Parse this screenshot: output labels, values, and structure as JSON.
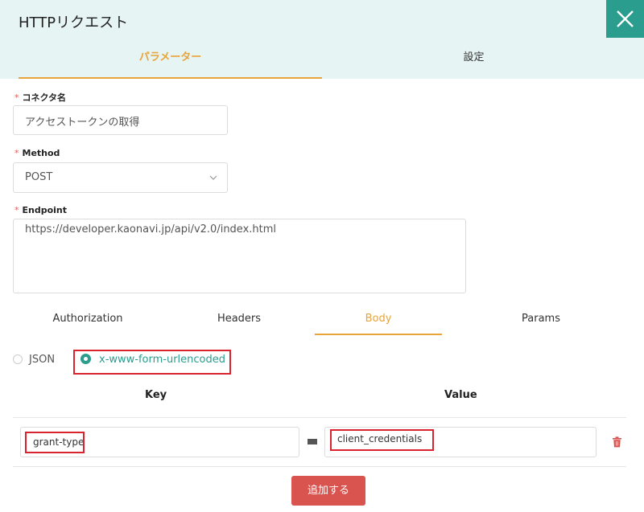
{
  "window": {
    "title": "HTTPリクエスト"
  },
  "tabs_top": [
    {
      "label": "パラメーター",
      "active": true
    },
    {
      "label": "設定",
      "active": false
    }
  ],
  "connector": {
    "label": "コネクタ名",
    "value": "アクセストークンの取得"
  },
  "method": {
    "label": "Method",
    "value": "POST"
  },
  "endpoint": {
    "label": "Endpoint",
    "value": "https://developer.kaonavi.jp/api/v2.0/index.html"
  },
  "required_mark": "*",
  "subtabs": [
    {
      "label": "Authorization",
      "active": false
    },
    {
      "label": "Headers",
      "active": false
    },
    {
      "label": "Body",
      "active": true
    },
    {
      "label": "Params",
      "active": false
    }
  ],
  "body_type": {
    "options": [
      {
        "label": "JSON",
        "selected": false
      },
      {
        "label": "x-www-form-urlencoded",
        "selected": true
      }
    ]
  },
  "kv_table": {
    "key_header": "Key",
    "value_header": "Value",
    "rows": [
      {
        "key": "grant-type",
        "value": "client_credentials"
      }
    ]
  },
  "add_button": "追加する",
  "colors": {
    "accent": "#e8a43a",
    "teal": "#2a9d8f",
    "danger": "#d9534f",
    "highlight": "#d9232e"
  },
  "icons": {
    "close": "close-icon",
    "chevron": "chevron-down-icon",
    "trash": "trash-icon"
  }
}
